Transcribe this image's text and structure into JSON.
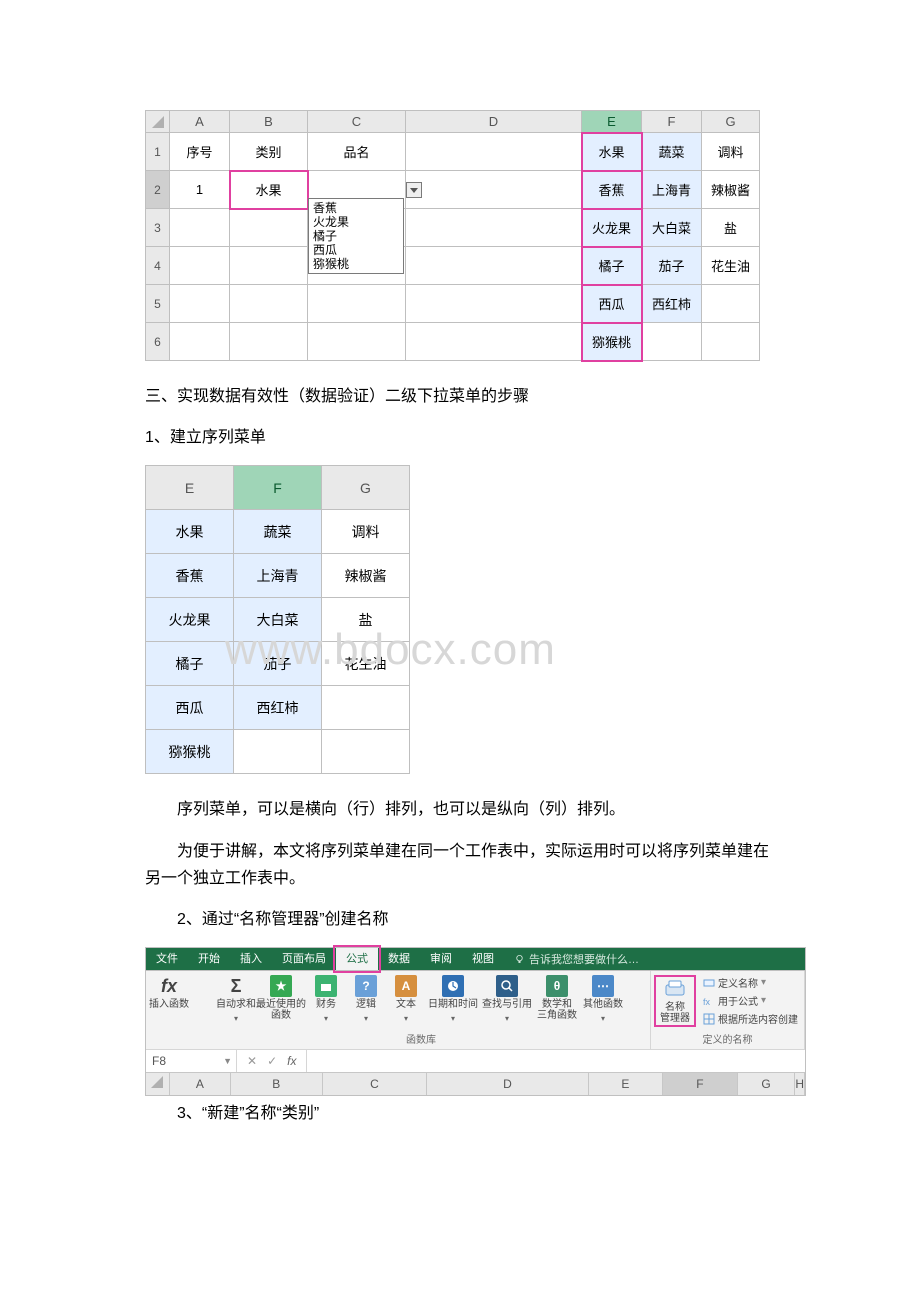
{
  "top_sheet": {
    "col_headers": [
      "A",
      "B",
      "C",
      "D",
      "E",
      "F",
      "G"
    ],
    "row_headers": [
      "1",
      "2",
      "3",
      "4",
      "5",
      "6"
    ],
    "r1": {
      "A": "序号",
      "B": "类别",
      "C": "品名",
      "E": "水果",
      "F": "蔬菜",
      "G": "调料"
    },
    "r2": {
      "A": "1",
      "B": "水果",
      "E": "香蕉",
      "F": "上海青",
      "G": "辣椒酱"
    },
    "dropdown": {
      "items": [
        "香蕉",
        "火龙果",
        "橘子",
        "西瓜",
        "猕猴桃"
      ]
    },
    "r3": {
      "E": "火龙果",
      "F": "大白菜",
      "G": "盐"
    },
    "r4": {
      "E": "橘子",
      "F": "茄子",
      "G": "花生油"
    },
    "r5": {
      "E": "西瓜",
      "F": "西红柿"
    },
    "r6": {
      "E": "猕猴桃"
    }
  },
  "text": {
    "h3": "三、实现数据有效性（数据验证）二级下拉菜单的步骤",
    "p1": "1、建立序列菜单",
    "p2": "序列菜单，可以是横向（行）排列，也可以是纵向（列）排列。",
    "p3": "为便于讲解，本文将序列菜单建在同一个工作表中，实际运用时可以将序列菜单建在另一个独立工作表中。",
    "p4": "2、通过“名称管理器”创建名称",
    "p5": "3、“新建”名称“类别”"
  },
  "cat_table": {
    "head": {
      "E": "E",
      "F": "F",
      "G": "G"
    },
    "r1": {
      "E": "水果",
      "F": "蔬菜",
      "G": "调料"
    },
    "r2": {
      "E": "香蕉",
      "F": "上海青",
      "G": "辣椒酱"
    },
    "r3": {
      "E": "火龙果",
      "F": "大白菜",
      "G": "盐"
    },
    "r4": {
      "E": "橘子",
      "F": "茄子",
      "G": "花生油"
    },
    "r5": {
      "E": "西瓜",
      "F": "西红柿"
    },
    "r6": {
      "E": "猕猴桃"
    }
  },
  "watermark": "www.bdocx.com",
  "ribbon": {
    "tabs": {
      "file": "文件",
      "home": "开始",
      "insert": "插入",
      "layout": "页面布局",
      "formula": "公式",
      "data": "数据",
      "review": "审阅",
      "view": "视图",
      "tell": "告诉我您想要做什么…"
    },
    "btn": {
      "insertfn": "插入函数",
      "autosum": "自动求和",
      "recent": "最近使用的\n函数",
      "finance": "财务",
      "logic": "逻辑",
      "text": "文本",
      "datetime": "日期和时间",
      "lookup": "查找与引用",
      "math": "数学和\n三角函数",
      "other": "其他函数",
      "namemgr": "名称\n管理器",
      "defname": "定义名称",
      "useinfm": "用于公式",
      "createfromsel": "根据所选内容创建"
    },
    "grp": {
      "fnlib": "函数库",
      "defnames": "定义的名称"
    },
    "namebox": "F8",
    "colheaders": [
      "A",
      "B",
      "C",
      "D",
      "E",
      "F",
      "G",
      "H"
    ]
  }
}
